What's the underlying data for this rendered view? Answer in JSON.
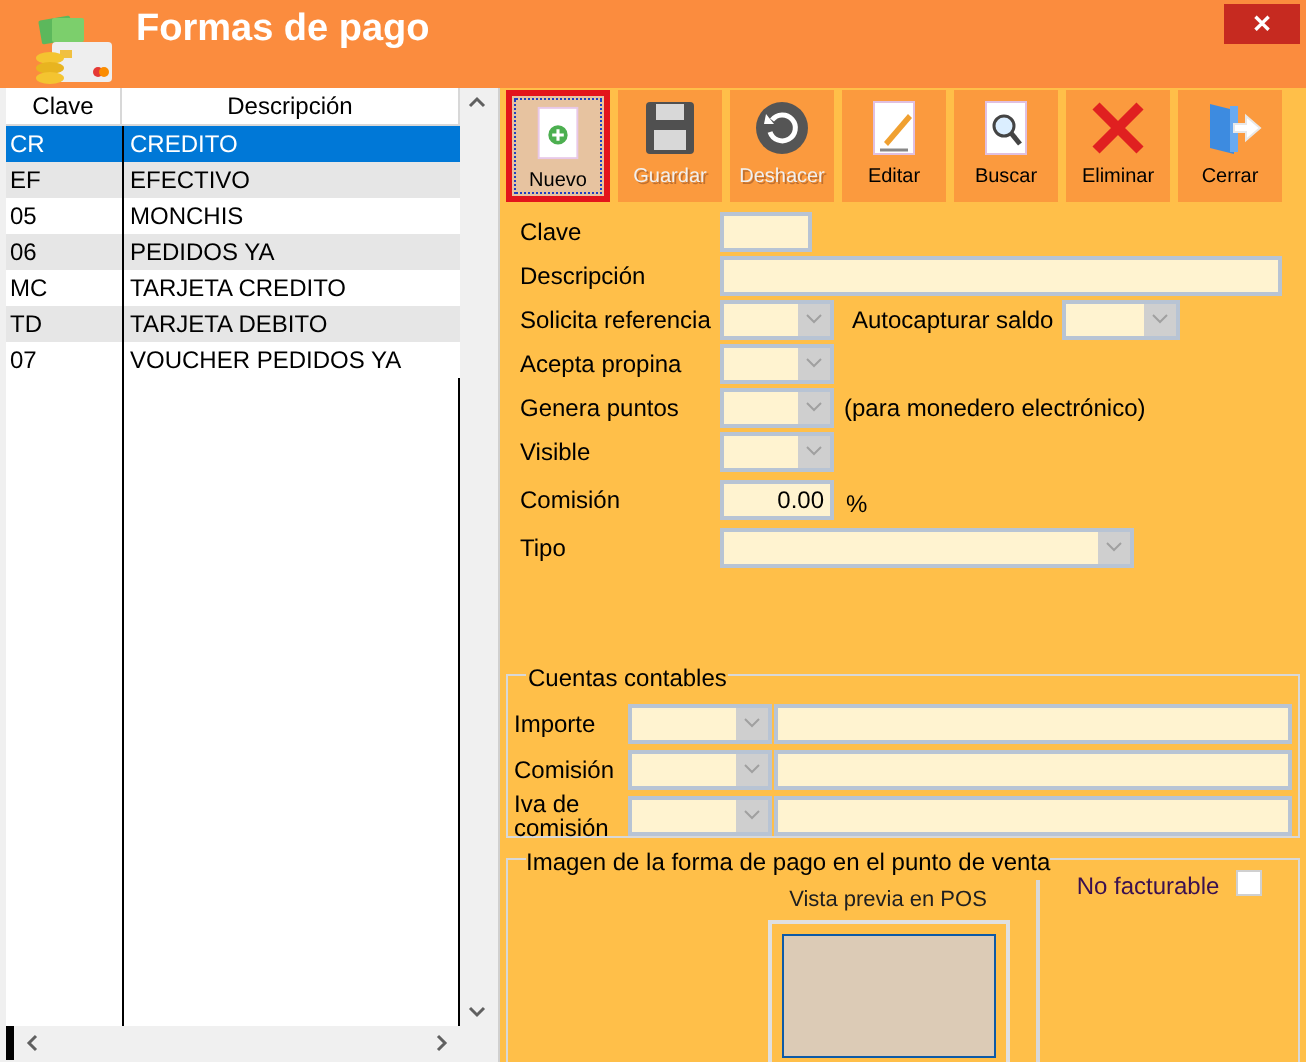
{
  "window": {
    "title": "Formas de pago",
    "close": "✕"
  },
  "grid": {
    "columns": [
      "Clave",
      "Descripción"
    ],
    "rows": [
      {
        "clave": "CR",
        "descripcion": "CREDITO",
        "selected": true
      },
      {
        "clave": "EF",
        "descripcion": "EFECTIVO",
        "selected": false
      },
      {
        "clave": "05",
        "descripcion": "MONCHIS",
        "selected": false
      },
      {
        "clave": "06",
        "descripcion": "PEDIDOS YA",
        "selected": false
      },
      {
        "clave": "MC",
        "descripcion": "TARJETA CREDITO",
        "selected": false
      },
      {
        "clave": "TD",
        "descripcion": "TARJETA DEBITO",
        "selected": false
      },
      {
        "clave": "07",
        "descripcion": "VOUCHER PEDIDOS YA",
        "selected": false
      }
    ]
  },
  "toolbar": [
    {
      "kind": "new",
      "label": "Nuevo",
      "disabled": false,
      "selected": true
    },
    {
      "kind": "save",
      "label": "Guardar",
      "disabled": true,
      "selected": false
    },
    {
      "kind": "undo",
      "label": "Deshacer",
      "disabled": true,
      "selected": false
    },
    {
      "kind": "edit",
      "label": "Editar",
      "disabled": false,
      "selected": false
    },
    {
      "kind": "search",
      "label": "Buscar",
      "disabled": false,
      "selected": false
    },
    {
      "kind": "delete",
      "label": "Eliminar",
      "disabled": false,
      "selected": false
    },
    {
      "kind": "close",
      "label": "Cerrar",
      "disabled": false,
      "selected": false
    }
  ],
  "form": {
    "clave": {
      "label": "Clave"
    },
    "descripcion": {
      "label": "Descripción"
    },
    "solicita_referencia": {
      "label": "Solicita referencia"
    },
    "autocapturar_saldo": {
      "label": "Autocapturar saldo"
    },
    "acepta_propina": {
      "label": "Acepta propina"
    },
    "genera_puntos": {
      "label": "Genera puntos",
      "note": "(para monedero electrónico)"
    },
    "visible": {
      "label": "Visible"
    },
    "comision": {
      "label": "Comisión",
      "value": "0.00",
      "unit": "%"
    },
    "tipo": {
      "label": "Tipo"
    }
  },
  "cuentas_contables": {
    "title": "Cuentas contables",
    "rows": [
      {
        "label": "Importe"
      },
      {
        "label": "Comisión"
      },
      {
        "label": "Iva de comisión"
      }
    ]
  },
  "imagen": {
    "title": "Imagen de la forma de pago en el punto de venta",
    "preview_label": "Vista previa en POS"
  },
  "no_facturable": {
    "label": "No facturable",
    "checked": false
  }
}
